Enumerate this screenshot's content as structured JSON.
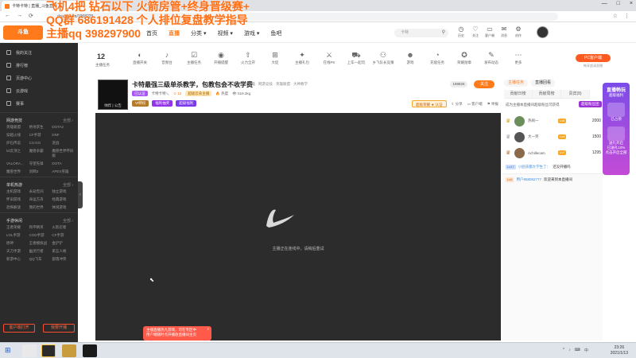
{
  "browser": {
    "tab_title": "卡特卡特 | 直播_斗鱼直播",
    "tab_close": "×",
    "new_tab": "+",
    "window_controls": [
      "—",
      "□",
      "×"
    ],
    "nav": [
      "←",
      "→",
      "⟳"
    ],
    "url": "douyu.com/1968229"
  },
  "overlay": {
    "line1": "飞机4把 钻石以下    火箭房管+终身晋级赛+",
    "line2": "QQ群 686191428          个人排位复盘教学指导",
    "line3": "主播qq 398297900"
  },
  "header": {
    "logo": "斗鱼",
    "nav": [
      {
        "label": "首页"
      },
      {
        "label": "直播",
        "active": true
      },
      {
        "label": "分类 ▾"
      },
      {
        "label": "视频 ▾"
      },
      {
        "label": "游戏 ▾"
      },
      {
        "label": "鱼吧"
      }
    ],
    "search_placeholder": "卡特",
    "search_icon": "search-icon",
    "icons": [
      {
        "glyph": "◷",
        "label": "历史"
      },
      {
        "glyph": "♡",
        "label": "关注"
      },
      {
        "glyph": "▭",
        "label": "客户端"
      },
      {
        "glyph": "✉",
        "label": "消息"
      },
      {
        "glyph": "⚙",
        "label": "创作"
      }
    ]
  },
  "sidebar": {
    "top_items": [
      {
        "label": "我的关注"
      },
      {
        "label": "排行榜"
      },
      {
        "label": "页游中心"
      },
      {
        "label": "云游戏"
      },
      {
        "label": "赛事"
      }
    ],
    "sections": [
      {
        "title": "网游竞技",
        "all": "全部 ›",
        "items": [
          "英雄联盟",
          "绝地求生",
          "DOTA2",
          "穿越火线",
          "CF手游",
          "DNF",
          "炉石传说",
          "CS:GO",
          "逆战",
          "lol云顶之",
          "魔兽争霸",
          "魔兽世界怀旧服",
          "VALORA...",
          "守望先锋",
          "DOTA",
          "魔兽世界",
          "剑网3",
          "APEX英雄"
        ]
      },
      {
        "title": "单机热游",
        "all": "全部 ›",
        "items": [
          "主机游戏",
          "永劫无间",
          "独立游戏",
          "怀旧游戏",
          "命运方舟",
          "经典游戏",
          "恐怖解谜",
          "我的世界",
          "休闲游戏"
        ]
      },
      {
        "title": "手游休闲",
        "all": "全部 ›",
        "items": [
          "王者荣耀",
          "和平精英",
          "火影忍者",
          "LOL手游",
          "COD手游",
          "CF手游",
          "原神",
          "王者模拟战",
          "金铲铲",
          "天刀手游",
          "幽灵行者",
          "第五人格",
          "新游中心",
          "QQ飞车",
          "部落冲突"
        ]
      }
    ],
    "btn_open": "客户端打开",
    "btn_live": "我要开播",
    "collapse": "‹"
  },
  "categories": {
    "count": "12",
    "count_label": "主播任务",
    "items": [
      {
        "glyph": "◐",
        "label": "直播开关"
      },
      {
        "glyph": "♪",
        "label": "音频台"
      },
      {
        "glyph": "☑",
        "label": "主播任务"
      },
      {
        "glyph": "◉",
        "label": "开播提醒"
      },
      {
        "glyph": "⇧",
        "label": "火力全开"
      },
      {
        "glyph": "⊞",
        "label": "大促"
      },
      {
        "glyph": "✦",
        "label": "主播礼包"
      },
      {
        "glyph": "⚔",
        "label": "在线PK"
      },
      {
        "glyph": "⛟",
        "label": "上车一起玩"
      },
      {
        "glyph": "⚇",
        "label": "乡飞队长竞猜"
      },
      {
        "glyph": "☻",
        "label": "游戏"
      },
      {
        "glyph": "◔",
        "label": "充能任务"
      },
      {
        "glyph": "✪",
        "label": "荣耀勋章"
      },
      {
        "glyph": "✎",
        "label": "发布动态"
      },
      {
        "glyph": "⋯",
        "label": "更多"
      }
    ],
    "pc_btn": "PC客户端",
    "pc_sub": "畅享超清直播"
  },
  "room": {
    "avatar_caption": "帅炸 | 公告",
    "title": "卡特最强三级单杀教学，包教包会不收学费",
    "tags": "英雄 · 网游竞技 · 英雄联盟 · 大神教学",
    "verify": "已认证",
    "streamer": "卡特卡特乀",
    "level": "12",
    "rank": "超级云朵主播",
    "hot_label": "热度",
    "views": "519.2kg",
    "badges": [
      "VI特权",
      "福利抽奖",
      "超级福利"
    ],
    "hot": "198826",
    "follow": "关注",
    "actions": {
      "lp_badge": "超级荣耀 ★ 认证",
      "share": "分享",
      "client": "客户端",
      "report": "举报"
    }
  },
  "player": {
    "message": "主播正在连线中，请稍后重试",
    "logo_icon": "douyu-fish-icon"
  },
  "toast": {
    "line1": "主播直播热九游戏，可在专区中",
    "line2": "用户端随时点开播放直播间主页",
    "close": "×"
  },
  "right_panel": {
    "tabs": [
      {
        "label": "主播任务",
        "active": true
      },
      {
        "label": "直播回看"
      }
    ],
    "subtabs": [
      "贡献日榜",
      "贡献周榜",
      "贵宾(8)"
    ],
    "promo_text": "成为主播本直播间超级粉丝可获得",
    "promo_btn": "超级粉丝团",
    "ranks": [
      {
        "name": "热闹一",
        "level": "Lv8",
        "score": "2000"
      },
      {
        "name": "大一笑",
        "level": "Lv9",
        "score": "1500"
      },
      {
        "name": "Achillecam",
        "level": "Lv7",
        "score": "1295"
      }
    ],
    "chats": [
      {
        "tag": "Lv17",
        "user": "小屁孩都大学生了：",
        "text": "还没开播吗"
      },
      {
        "tag": "Lv6",
        "user": "用户858082777",
        "text": "欢迎来到本直播间"
      }
    ]
  },
  "float_promo": {
    "title": "直播畅玩",
    "line1": "超级福利",
    "line2": "已占领",
    "line3": "送礼开启",
    "line4": "已送礼10%",
    "line5": "点击开启全部"
  },
  "taskbar": {
    "start": "⊞",
    "tray": [
      "^",
      "♪",
      "⌨",
      "中"
    ],
    "time": "23:26",
    "date": "2021/1/13"
  },
  "colors": {
    "accent": "#ff7a1a",
    "sidebar": "#2b2b2b",
    "player_bg": "#2c2c2c",
    "overlay": "#ff6f16"
  }
}
